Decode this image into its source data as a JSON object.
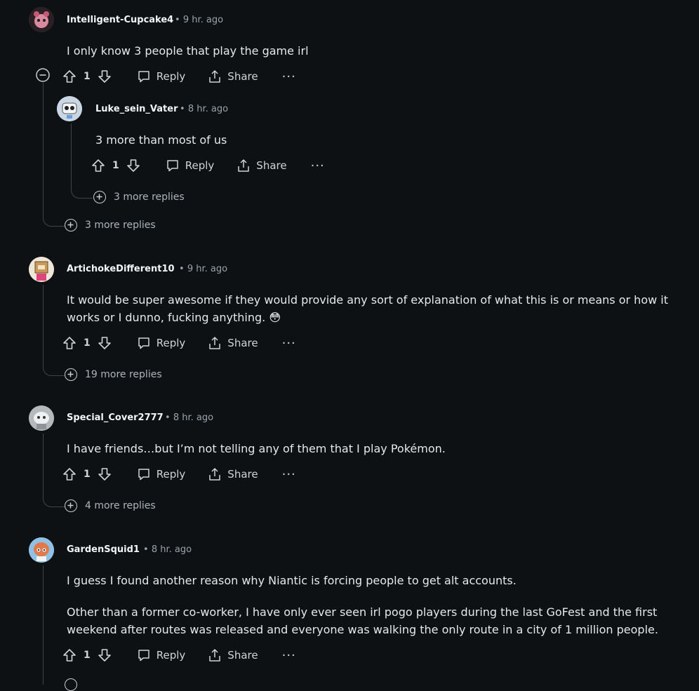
{
  "comments": [
    {
      "username": "Intelligent-Cupcake4",
      "time": "9 hr. ago",
      "text": "I only know 3 people that play the game irl",
      "votes": "1",
      "more_replies": "3 more replies",
      "reply": {
        "username": "Luke_sein_Vater",
        "time": "8 hr. ago",
        "text": "3 more than most of us",
        "votes": "1",
        "more_replies": "3 more replies"
      }
    },
    {
      "username": "ArtichokeDifferent10",
      "time": "9 hr. ago",
      "text": "It would be super awesome if they would provide any sort of explanation of what this is or means or how it works or I dunno, fucking anything. 😳",
      "votes": "1",
      "more_replies": "19 more replies"
    },
    {
      "username": "Special_Cover2777",
      "time": "8 hr. ago",
      "text": "I have friends…but I’m not telling any of them that I play Pokémon.",
      "votes": "1",
      "more_replies": "4 more replies"
    },
    {
      "username": "GardenSquid1",
      "time": "8 hr. ago",
      "text": "I guess I found another reason why Niantic is forcing people to get alt accounts.",
      "text2": "Other than a former co-worker, I have only ever seen irl pogo players during the last GoFest and the first weekend after routes was released and everyone was walking the only route in a city of 1 million people.",
      "votes": "1"
    }
  ],
  "labels": {
    "reply": "Reply",
    "share": "Share",
    "bullet": "•",
    "more": "···"
  },
  "icons": [
    "upvote-icon",
    "downvote-icon",
    "reply-icon",
    "share-icon",
    "collapse-icon",
    "expand-icon"
  ],
  "colors": {
    "background": "#0e1113",
    "thread_line": "#3e4448",
    "text": "#e6e8ea"
  }
}
